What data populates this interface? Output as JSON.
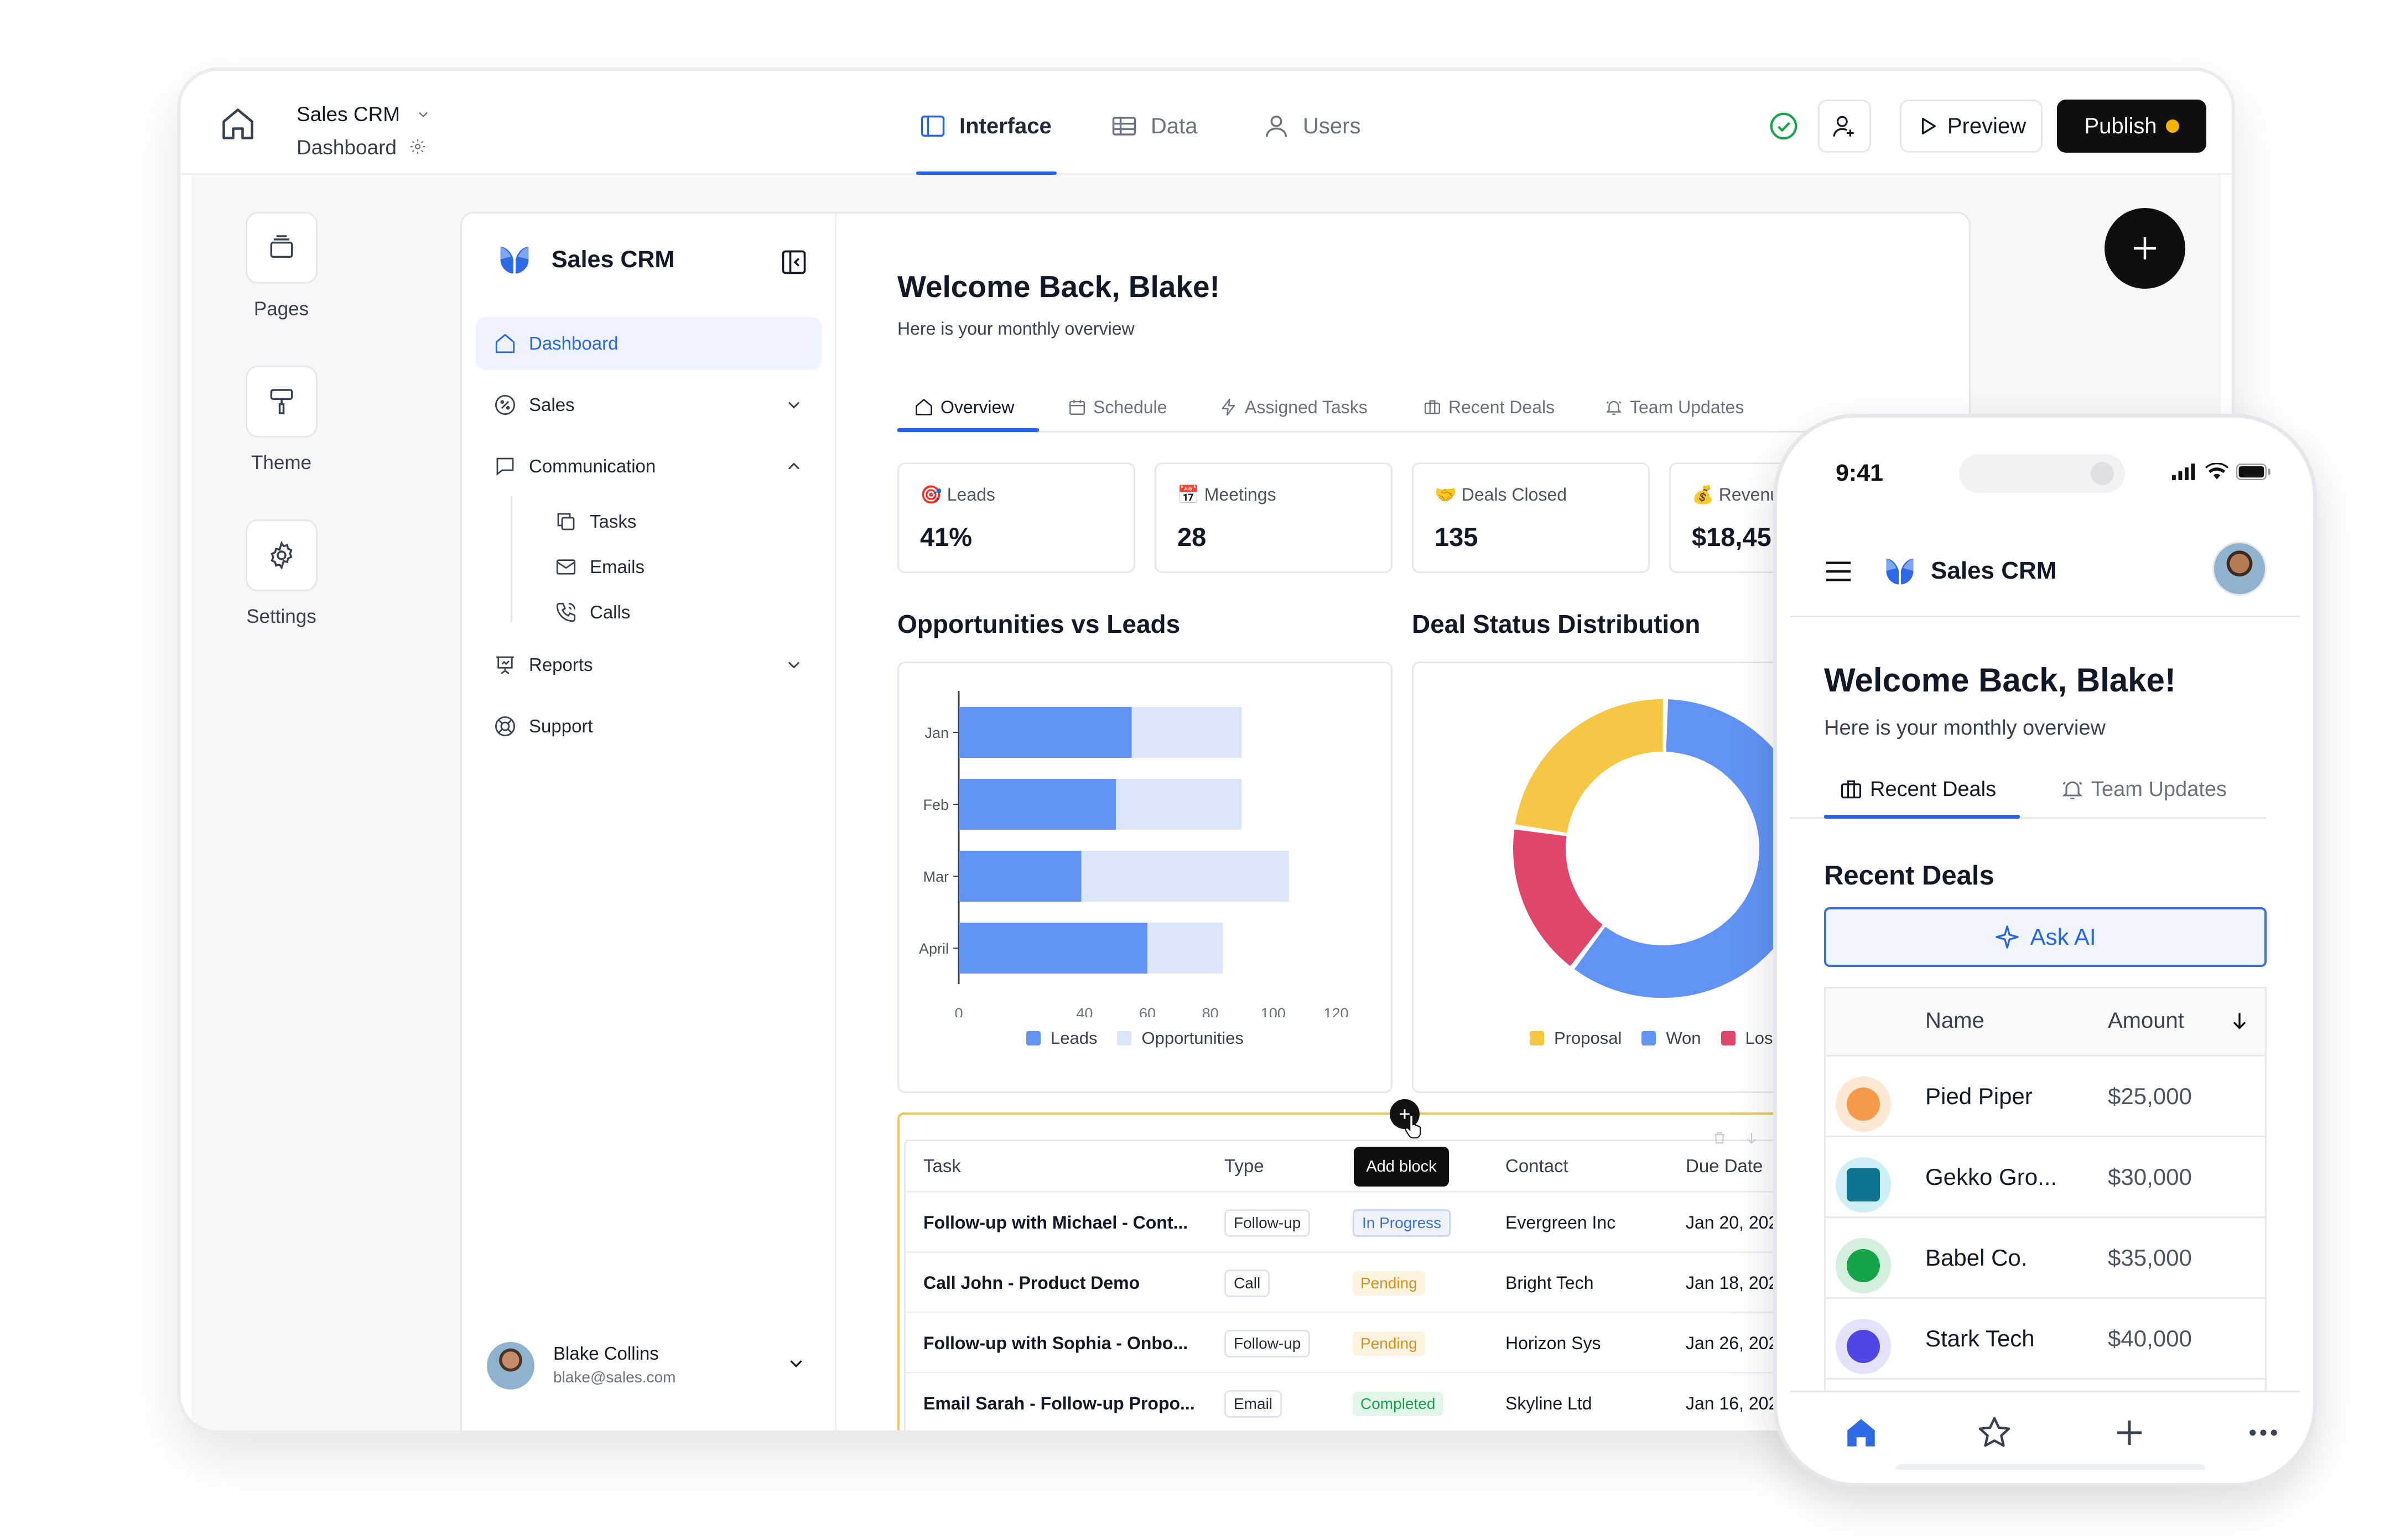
{
  "topbar": {
    "app_name": "Sales CRM",
    "page_name": "Dashboard",
    "tabs": [
      {
        "label": "Interface",
        "icon": "layout-icon",
        "active": true
      },
      {
        "label": "Data",
        "icon": "table-icon",
        "active": false
      },
      {
        "label": "Users",
        "icon": "user-icon",
        "active": false
      }
    ],
    "preview_label": "Preview",
    "publish_label": "Publish",
    "colors": {
      "accent": "#2563eb",
      "publish_bg": "#0f0f10",
      "publish_dot": "#f5b300",
      "status_ok": "#16a34a"
    }
  },
  "rail": {
    "items": [
      {
        "label": "Pages",
        "icon": "pages-icon"
      },
      {
        "label": "Theme",
        "icon": "paint-roller-icon"
      },
      {
        "label": "Settings",
        "icon": "gear-icon"
      }
    ]
  },
  "sidenav": {
    "brand": "Sales CRM",
    "items": [
      {
        "label": "Dashboard",
        "icon": "home-icon"
      },
      {
        "label": "Sales",
        "icon": "percent-badge-icon"
      },
      {
        "label": "Communication",
        "icon": "message-square-icon"
      },
      {
        "label": "Reports",
        "icon": "presentation-icon"
      },
      {
        "label": "Support",
        "icon": "lifebuoy-icon"
      }
    ],
    "sub_items": [
      {
        "label": "Tasks",
        "icon": "copy-icon"
      },
      {
        "label": "Emails",
        "icon": "mail-icon"
      },
      {
        "label": "Calls",
        "icon": "phone-icon"
      }
    ],
    "user": {
      "name": "Blake Collins",
      "email": "blake@sales.com"
    }
  },
  "main": {
    "title": "Welcome Back, Blake!",
    "subtitle": "Here is your monthly overview",
    "tabs": [
      {
        "label": "Overview",
        "icon": "home-icon"
      },
      {
        "label": "Schedule",
        "icon": "calendar-icon"
      },
      {
        "label": "Assigned Tasks",
        "icon": "bolt-icon"
      },
      {
        "label": "Recent Deals",
        "icon": "briefcase-icon"
      },
      {
        "label": "Team Updates",
        "icon": "bell-icon"
      }
    ],
    "stats": [
      {
        "emoji": "🎯",
        "label": "Leads",
        "value": "41%"
      },
      {
        "emoji": "📅",
        "label": "Meetings",
        "value": "28"
      },
      {
        "emoji": "🤝",
        "label": "Deals Closed",
        "value": "135"
      },
      {
        "emoji": "💰",
        "label": "Revenu",
        "value": "$18,45"
      }
    ],
    "bar_chart_title": "Opportunities vs Leads",
    "donut_chart_title": "Deal Status Distribution",
    "add_block_label": "Add block",
    "table": {
      "columns": [
        "Task",
        "Type",
        "Contact",
        "Due Date"
      ],
      "rows": [
        {
          "task": "Follow-up with Michael - Cont...",
          "type": "Follow-up",
          "status": "In Progress",
          "contact": "Evergreen Inc",
          "due": "Jan 20, 202"
        },
        {
          "task": "Call John - Product Demo",
          "type": "Call",
          "status": "Pending",
          "contact": "Bright Tech",
          "due": "Jan 18, 202"
        },
        {
          "task": "Follow-up with Sophia - Onbo...",
          "type": "Follow-up",
          "status": "Pending",
          "contact": "Horizon Sys",
          "due": "Jan 26, 202"
        },
        {
          "task": "Email Sarah - Follow-up Propo...",
          "type": "Email",
          "status": "Completed",
          "contact": "Skyline Ltd",
          "due": "Jan 16, 202"
        }
      ]
    }
  },
  "chart_data": [
    {
      "type": "bar",
      "orientation": "horizontal",
      "stacked": true,
      "title": "Opportunities vs Leads",
      "categories": [
        "Jan",
        "Feb",
        "Mar",
        "April"
      ],
      "series": [
        {
          "name": "Leads",
          "values": [
            55,
            50,
            39,
            60
          ],
          "color": "#6193f5"
        },
        {
          "name": "Opportunities",
          "values": [
            35,
            40,
            66,
            24
          ],
          "color": "#dce6fb"
        }
      ],
      "xlim": [
        0,
        120
      ],
      "xticks": [
        0,
        40,
        60,
        80,
        100,
        120
      ],
      "legend": "bottom"
    },
    {
      "type": "pie",
      "donut": true,
      "title": "Deal Status Distribution",
      "labels": [
        "Won",
        "Lost",
        "Proposal"
      ],
      "values": [
        60,
        17,
        23
      ],
      "colors": [
        "#6193f5",
        "#e0456a",
        "#f6c744"
      ],
      "legend": "bottom",
      "legend_labels": [
        "Proposal",
        "Won",
        "Los"
      ]
    }
  ],
  "phone": {
    "time": "9:41",
    "brand": "Sales CRM",
    "title": "Welcome Back, Blake!",
    "subtitle": "Here is your monthly overview",
    "tabs": [
      {
        "label": "Recent Deals",
        "icon": "briefcase-icon"
      },
      {
        "label": "Team Updates",
        "icon": "bell-icon"
      }
    ],
    "section_title": "Recent Deals",
    "ask_ai_label": "Ask AI",
    "table_headers": {
      "name": "Name",
      "amount": "Amount"
    },
    "deals": [
      {
        "name": "Pied Piper",
        "amount": "$25,000",
        "logo_color": "#f49a4a",
        "logo_bg": "#fde8d4"
      },
      {
        "name": "Gekko Gro...",
        "amount": "$30,000",
        "logo_color": "#0e7490",
        "logo_bg": "#cdeff5"
      },
      {
        "name": "Babel Co.",
        "amount": "$35,000",
        "logo_color": "#16a34a",
        "logo_bg": "#d3f0dc"
      },
      {
        "name": "Stark Tech",
        "amount": "$40,000",
        "logo_color": "#4f46e5",
        "logo_bg": "#e3e2fb"
      }
    ]
  }
}
